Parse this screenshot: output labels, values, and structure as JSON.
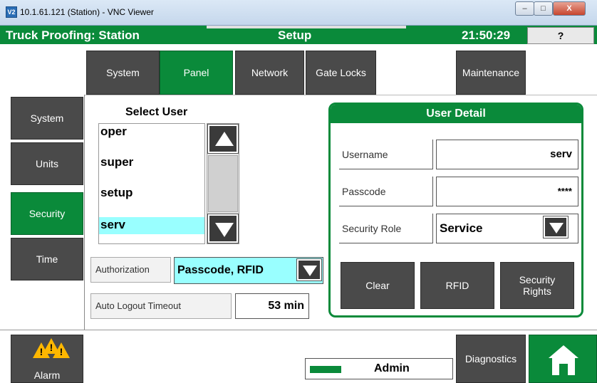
{
  "window": {
    "title": "10.1.61.121 (Station) - VNC Viewer",
    "icon_text": "V2",
    "minimize": "–",
    "maximize": "□",
    "close": "X"
  },
  "header": {
    "title": "Truck Proofing: Station",
    "screen": "Setup",
    "time": "21:50:29",
    "help": "?"
  },
  "top_tabs": [
    "System",
    "Panel",
    "Network",
    "Gate Locks",
    "Maintenance"
  ],
  "top_tab_active": "Panel",
  "left_tabs": [
    "System",
    "Units",
    "Security",
    "Time"
  ],
  "left_tab_active": "Security",
  "select_user": {
    "title": "Select User",
    "users": [
      "oper",
      "super",
      "setup",
      "serv"
    ],
    "selected": "serv"
  },
  "authorization": {
    "label": "Authorization",
    "value": "Passcode, RFID"
  },
  "auto_logout": {
    "label": "Auto Logout Timeout",
    "value": "53 min"
  },
  "user_detail": {
    "title": "User Detail",
    "username_label": "Username",
    "username_value": "serv",
    "passcode_label": "Passcode",
    "passcode_value": "****",
    "role_label": "Security Role",
    "role_value": "Service",
    "buttons": [
      "Clear",
      "RFID",
      "Security Rights"
    ]
  },
  "bottom": {
    "alarm_label": "Alarm",
    "user_label": "Admin",
    "diagnostics_label": "Diagnostics"
  },
  "colors": {
    "accent_green": "#0a8a3a",
    "button_gray": "#4a4a4a",
    "highlight_cyan": "#99ffff",
    "warning_yellow": "#ffb700"
  },
  "icons": [
    "vnc-icon",
    "arrow-up-icon",
    "arrow-down-icon",
    "dropdown-arrow-icon",
    "warning-icon",
    "key-icon",
    "home-icon"
  ]
}
